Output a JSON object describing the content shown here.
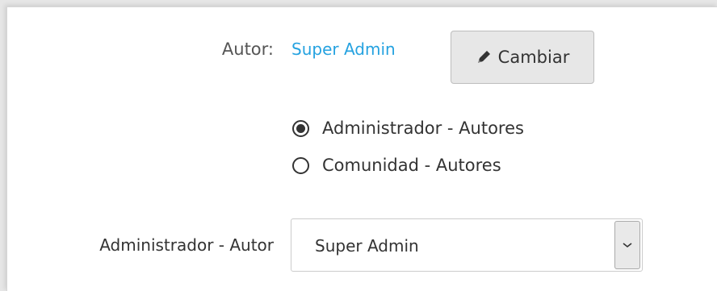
{
  "author": {
    "label": "Autor:",
    "name": "Super Admin",
    "change_button": "Cambiar"
  },
  "author_source": {
    "options": [
      {
        "label": "Administrador - Autores",
        "checked": true
      },
      {
        "label": "Comunidad - Autores",
        "checked": false
      }
    ]
  },
  "admin_author_select": {
    "label": "Administrador - Autor",
    "value": "Super Admin"
  },
  "icons": {
    "change_button": "pencil-icon",
    "select_toggle": "chevron-down-icon"
  }
}
